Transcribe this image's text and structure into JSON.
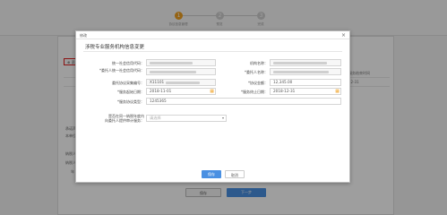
{
  "steps": [
    {
      "num": "1",
      "label": "协议信息管理"
    },
    {
      "num": "2",
      "label": "预览"
    },
    {
      "num": "3",
      "label": "完成"
    }
  ],
  "toolbar": {
    "add_label": "添加",
    "edit_label": "修改"
  },
  "background": {
    "col_number": "序号",
    "col_end": "服务结束时间",
    "row_number": "1",
    "row_end": "12-31",
    "note_label": "承诺声明：",
    "note_text": "本单位提供的资料",
    "sign_label": "纳税人签章：（签章）",
    "sign_person": "纳税人（签）：",
    "date_label": "年　月　日"
  },
  "modal": {
    "window_title": "修改",
    "close_icon": "×",
    "title": "涉税专业服务机构信息变更",
    "fields": {
      "credit_code_label": "统一社会信用代码：",
      "org_name_label": "机构名称：",
      "client_credit_code_label": "*委托人统一社会信用代码：",
      "client_name_label": "*委托人名称：",
      "agreement_no_label": "委托协议采集编号：",
      "agreement_no_prefix": "X11101",
      "amount_label": "*协议金额：",
      "amount_value": "12,345.00",
      "start_date_label": "*服务起始日期：",
      "start_date_value": "2018-11-01",
      "end_date_label": "*服务终止日期：",
      "end_date_value": "2018-12-31",
      "service_type_label": "*服务协议类型：",
      "service_type_value": "1245365",
      "relation_label_1": "是否在同一纳税年度内",
      "relation_label_2": "向委托人提供审计服务：",
      "relation_placeholder": "请选择"
    },
    "save_label": "保存",
    "cancel_label": "取消"
  },
  "bottom": {
    "prev_label": "保存",
    "next_label": "下一步"
  },
  "colors": {
    "accent_blue": "#4a90e2",
    "step_active": "#f0a020",
    "highlight_red": "#e02020"
  }
}
